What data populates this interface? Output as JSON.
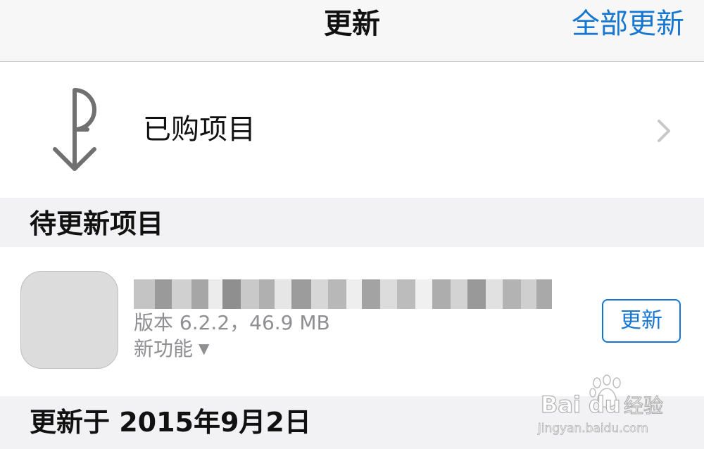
{
  "navbar": {
    "title": "更新",
    "update_all_label": "全部更新"
  },
  "purchased": {
    "label": "已购项目",
    "icon": "purchased-arrow-icon"
  },
  "sections": {
    "pending_label": "待更新项目",
    "updated_on_label": "更新于 2015年9月2日"
  },
  "app": {
    "name": "",
    "version_info": "版本 6.2.2，46.9 MB",
    "whats_new_label": "新功能",
    "whats_new_caret": "▼",
    "update_label": "更新"
  },
  "colors": {
    "accent": "#1677d2",
    "secondary_text": "#8e8e93",
    "section_bg": "#f2f2f4",
    "navbar_bg": "#f7f7f7"
  },
  "watermark": {
    "brand": "Bai du 经验",
    "url": "jingyan.baidu.com"
  }
}
